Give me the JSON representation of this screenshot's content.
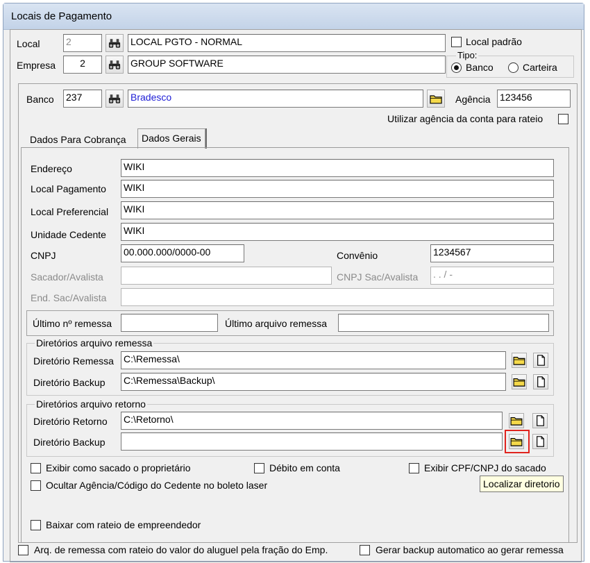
{
  "window": {
    "title": "Locais de Pagamento"
  },
  "top": {
    "local_label": "Local",
    "local_code": "2",
    "local_name": "LOCAL PGTO - NORMAL",
    "local_padrao_label": "Local padrão",
    "empresa_label": "Empresa",
    "empresa_code": "2",
    "empresa_name": "GROUP SOFTWARE",
    "tipo_label": "Tipo:",
    "tipo_banco": "Banco",
    "tipo_carteira": "Carteira",
    "tipo_selected": "Banco"
  },
  "bank": {
    "banco_label": "Banco",
    "banco_code": "237",
    "banco_name": "Bradesco",
    "agencia_label": "Agência",
    "agencia_value": "123456",
    "rateio_label": "Utilizar agência da conta para rateio"
  },
  "tabs": [
    {
      "label": "Dados Para Cobrança",
      "active": false
    },
    {
      "label": "Dados Gerais",
      "active": true
    }
  ],
  "form": {
    "endereco_label": "Endereço",
    "endereco_value": "WIKI",
    "local_pagamento_label": "Local Pagamento",
    "local_pagamento_value": "WIKI",
    "local_preferencial_label": "Local Preferencial",
    "local_preferencial_value": "WIKI",
    "unidade_cedente_label": "Unidade Cedente",
    "unidade_cedente_value": "WIKI",
    "cnpj_label": "CNPJ",
    "cnpj_value": "00.000.000/0000-00",
    "convenio_label": "Convênio",
    "convenio_value": "1234567",
    "sacador_label": "Sacador/Avalista",
    "sacador_value": "",
    "cnpj_sac_label": "CNPJ Sac/Avalista",
    "cnpj_sac_value": " .  .  /  -",
    "end_sac_label": "End. Sac/Avalista",
    "end_sac_value": "",
    "ultimo_remessa_label": "Último nº remessa",
    "ultimo_remessa_value": "",
    "ultimo_arquivo_label": "Último arquivo remessa",
    "ultimo_arquivo_value": ""
  },
  "remessa": {
    "group_title": "Diretórios arquivo remessa",
    "dir_remessa_label": "Diretório Remessa",
    "dir_remessa_value": "C:\\Remessa\\",
    "dir_backup_label": "Diretório Backup",
    "dir_backup_value": "C:\\Remessa\\Backup\\"
  },
  "retorno": {
    "group_title": "Diretórios arquivo retorno",
    "dir_retorno_label": "Diretório Retorno",
    "dir_retorno_value": "C:\\Retorno\\",
    "dir_backup_label": "Diretório Backup",
    "dir_backup_value": ""
  },
  "options": {
    "exibir_sacado": "Exibir como sacado o proprietário",
    "debito_conta": "Débito em conta",
    "exibir_cpf": "Exibir CPF/CNPJ do sacado",
    "ocultar_agencia": "Ocultar Agência/Código do Cedente no boleto laser",
    "baixar_rateio": "Baixar com rateio de empreendedor"
  },
  "tooltip": {
    "text": "Localizar diretorio"
  },
  "bottom": {
    "arq_remessa": "Arq. de remessa com rateio do valor do aluguel pela fração do Emp.",
    "gerar_backup": "Gerar backup automatico ao gerar remessa"
  },
  "icons": [
    "binoculars-icon",
    "folder-icon",
    "new-file-icon"
  ],
  "colors": {
    "titlebar": "#c8d7ea",
    "link_blue": "#1d1dd6",
    "highlight": "#e0231e",
    "folder_yellow": "#f5d94a",
    "tooltip_bg": "#ffffe1"
  }
}
